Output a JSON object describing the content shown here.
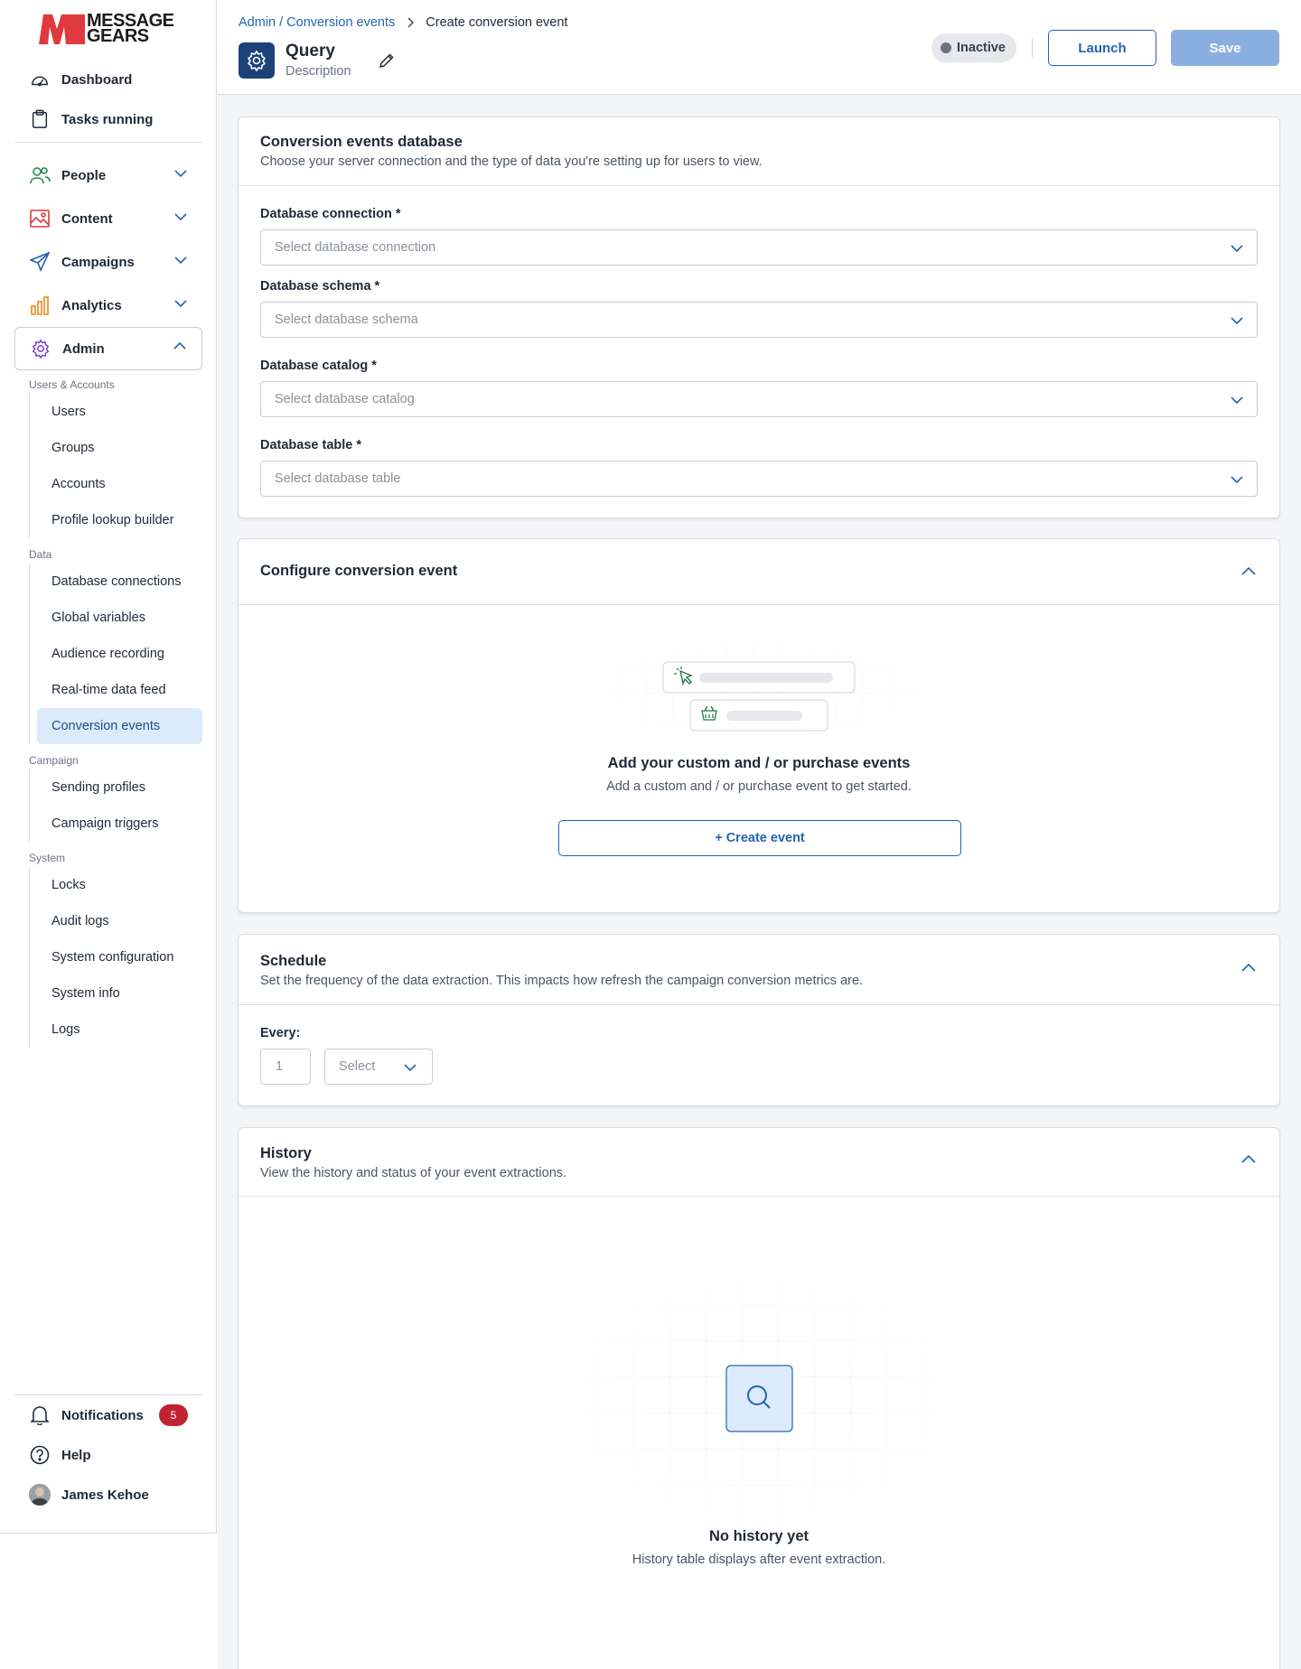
{
  "brand": {
    "line1": "MESSAGE",
    "line2": "GEARS",
    "color": "#e03a3e"
  },
  "nav_top": [
    {
      "label": "Dashboard",
      "icon": "gauge-icon"
    },
    {
      "label": "Tasks running",
      "icon": "clipboard-icon"
    }
  ],
  "nav_main": [
    {
      "label": "People",
      "icon": "people-icon",
      "expanded": false
    },
    {
      "label": "Content",
      "icon": "image-icon",
      "expanded": false
    },
    {
      "label": "Campaigns",
      "icon": "send-icon",
      "expanded": false
    },
    {
      "label": "Analytics",
      "icon": "bar-chart-icon",
      "expanded": false
    },
    {
      "label": "Admin",
      "icon": "gear-icon",
      "expanded": true
    }
  ],
  "admin_groups": [
    {
      "label": "Users & Accounts",
      "items": [
        "Users",
        "Groups",
        "Accounts",
        "Profile lookup builder"
      ]
    },
    {
      "label": "Data",
      "items": [
        "Database connections",
        "Global variables",
        "Audience recording",
        "Real-time data feed",
        "Conversion events"
      ]
    },
    {
      "label": "Campaign",
      "items": [
        "Sending profiles",
        "Campaign triggers"
      ]
    },
    {
      "label": "System",
      "items": [
        "Locks",
        "Audit logs",
        "System configuration",
        "System info",
        "Logs"
      ]
    }
  ],
  "active_item": "Conversion events",
  "sidebar_bottom": {
    "notifications": {
      "label": "Notifications",
      "count": "5"
    },
    "help": "Help",
    "user": "James Kehoe"
  },
  "header": {
    "breadcrumb_link": "Admin / Conversion events",
    "breadcrumb_current": "Create conversion event",
    "title": "Query",
    "description": "Description",
    "status": "Inactive",
    "launch": "Launch",
    "save": "Save"
  },
  "db_card": {
    "title": "Conversion events database",
    "subtitle": "Choose your server connection and the type of data you're setting up for users to view.",
    "fields": [
      {
        "label": "Database connection *",
        "placeholder": "Select database connection"
      },
      {
        "label": "Database schema *",
        "placeholder": "Select database schema"
      },
      {
        "label": "Database catalog *",
        "placeholder": "Select database catalog"
      },
      {
        "label": "Database table *",
        "placeholder": "Select database table"
      }
    ]
  },
  "configure_card": {
    "title": "Configure conversion event",
    "empty_title": "Add your custom and / or purchase events",
    "empty_sub": "Add a custom and / or purchase event to get started.",
    "button": "+ Create event"
  },
  "schedule_card": {
    "title": "Schedule",
    "subtitle": "Set the frequency of the data extraction. This impacts how refresh the campaign conversion metrics are.",
    "every_label": "Every:",
    "every_value": "1",
    "unit_placeholder": "Select"
  },
  "history_card": {
    "title": "History",
    "subtitle": "View the history and status of your event extractions.",
    "empty_title": "No history yet",
    "empty_sub": "History table displays after event extraction."
  },
  "colors": {
    "primary": "#2563b0",
    "badge": "#c0232f",
    "active_bg": "#dcebfb",
    "save_disabled": "#8aaee0"
  }
}
